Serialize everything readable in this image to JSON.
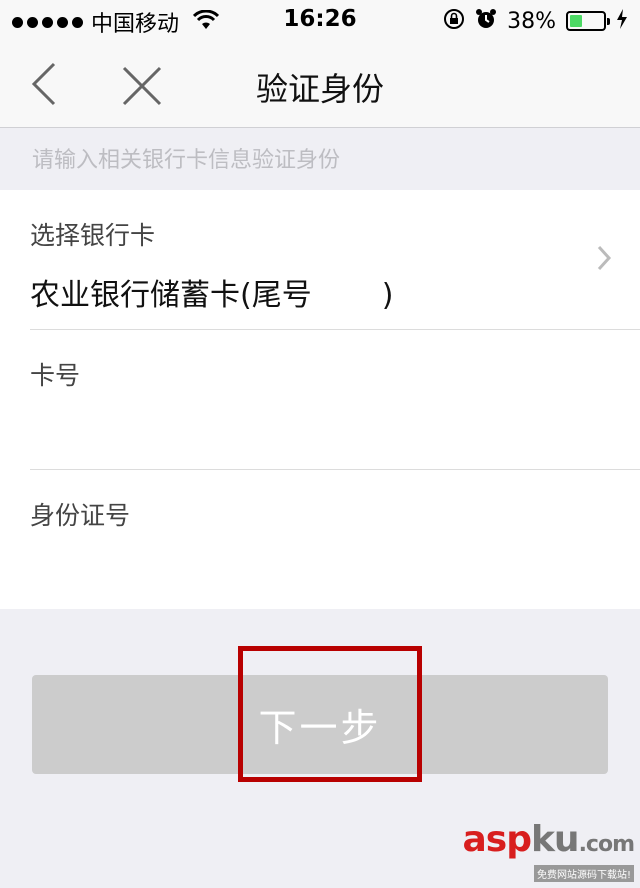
{
  "status_bar": {
    "carrier": "中国移动",
    "time": "16:26",
    "battery_percent": "38%",
    "battery_level": 0.38,
    "icons": [
      "signal-dots-icon",
      "wifi-icon",
      "rotation-lock-icon",
      "alarm-icon",
      "battery-icon",
      "charging-bolt-icon"
    ]
  },
  "nav": {
    "title": "验证身份"
  },
  "hint": "请输入相关银行卡信息验证身份",
  "form": {
    "bank_card": {
      "label": "选择银行卡",
      "value": "农业银行储蓄卡(尾号",
      "value_suffix": ")"
    },
    "card_number": {
      "label": "卡号"
    },
    "id_number": {
      "label": "身份证号"
    }
  },
  "next_button": {
    "label": "下一步"
  },
  "watermark": {
    "brand_red": "asp",
    "brand_gray": "ku",
    "suffix": ".com",
    "sub": "免费网站源码下载站!"
  },
  "colors": {
    "background": "#efeff4",
    "button_disabled": "#cccccc",
    "highlight": "#b80000",
    "battery_fill": "#4cd964"
  }
}
